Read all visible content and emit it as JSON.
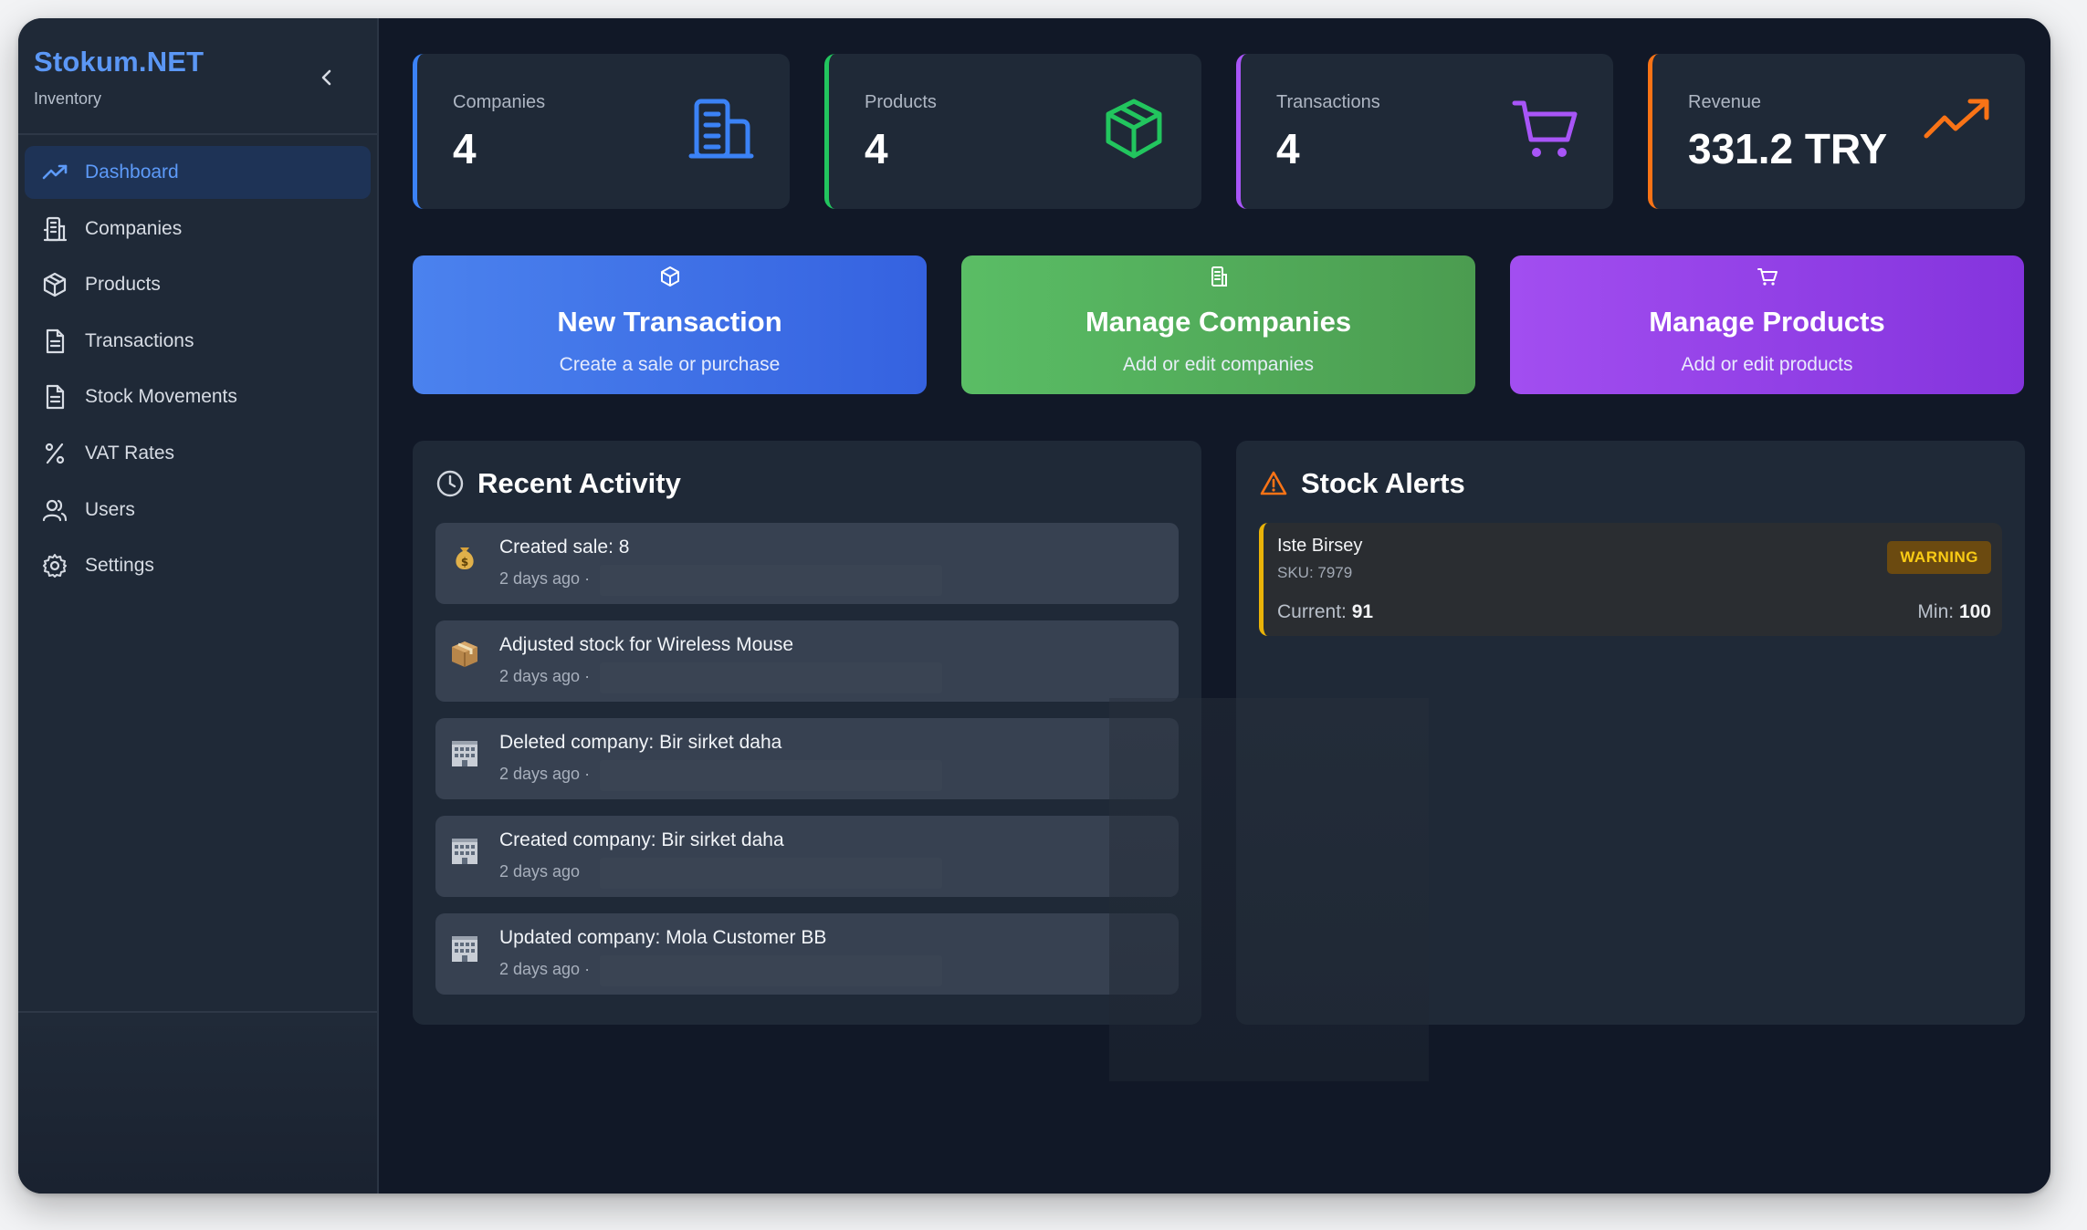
{
  "app": {
    "brand": "Stokum.NET",
    "subtitle": "Inventory"
  },
  "sidebar": {
    "collapse_icon": "chevron-left-icon",
    "items": [
      {
        "label": "Dashboard",
        "icon": "trend-up-icon",
        "active": true
      },
      {
        "label": "Companies",
        "icon": "building-icon"
      },
      {
        "label": "Products",
        "icon": "package-icon"
      },
      {
        "label": "Transactions",
        "icon": "document-icon"
      },
      {
        "label": "Stock Movements",
        "icon": "document-icon"
      },
      {
        "label": "VAT Rates",
        "icon": "percent-icon"
      },
      {
        "label": "Users",
        "icon": "users-icon"
      },
      {
        "label": "Settings",
        "icon": "gear-icon"
      }
    ]
  },
  "stats": [
    {
      "label": "Companies",
      "value": "4",
      "icon": "building-icon",
      "color": "#3b82f6"
    },
    {
      "label": "Products",
      "value": "4",
      "icon": "package-icon",
      "color": "#22c55e"
    },
    {
      "label": "Transactions",
      "value": "4",
      "icon": "cart-icon",
      "color": "#a855f7"
    },
    {
      "label": "Revenue",
      "value": "331.2 TRY",
      "icon": "trend-up-icon",
      "color": "#f97316"
    }
  ],
  "actions": [
    {
      "title": "New Transaction",
      "subtitle": "Create a sale or purchase",
      "icon": "package-icon"
    },
    {
      "title": "Manage Companies",
      "subtitle": "Add or edit companies",
      "icon": "building-icon"
    },
    {
      "title": "Manage Products",
      "subtitle": "Add or edit products",
      "icon": "cart-icon"
    }
  ],
  "activity": {
    "title": "Recent Activity",
    "items": [
      {
        "emoji": "money-bag-icon",
        "text": "Created sale: 8",
        "meta": "2 days ago ·"
      },
      {
        "emoji": "box-icon",
        "text": "Adjusted stock for Wireless Mouse",
        "meta": "2 days ago ·"
      },
      {
        "emoji": "office-building-icon",
        "text": "Deleted company: Bir sirket daha",
        "meta": "2 days ago ·"
      },
      {
        "emoji": "office-building-icon",
        "text": "Created company: Bir sirket daha",
        "meta": "2 days ago"
      },
      {
        "emoji": "office-building-icon",
        "text": "Updated company: Mola Customer BB",
        "meta": "2 days ago ·"
      }
    ]
  },
  "alerts": {
    "title": "Stock Alerts",
    "items": [
      {
        "name": "Iste Birsey",
        "sku": "SKU: 7979",
        "badge": "WARNING",
        "current_label": "Current:",
        "current": "91",
        "min_label": "Min:",
        "min": "100"
      }
    ]
  }
}
